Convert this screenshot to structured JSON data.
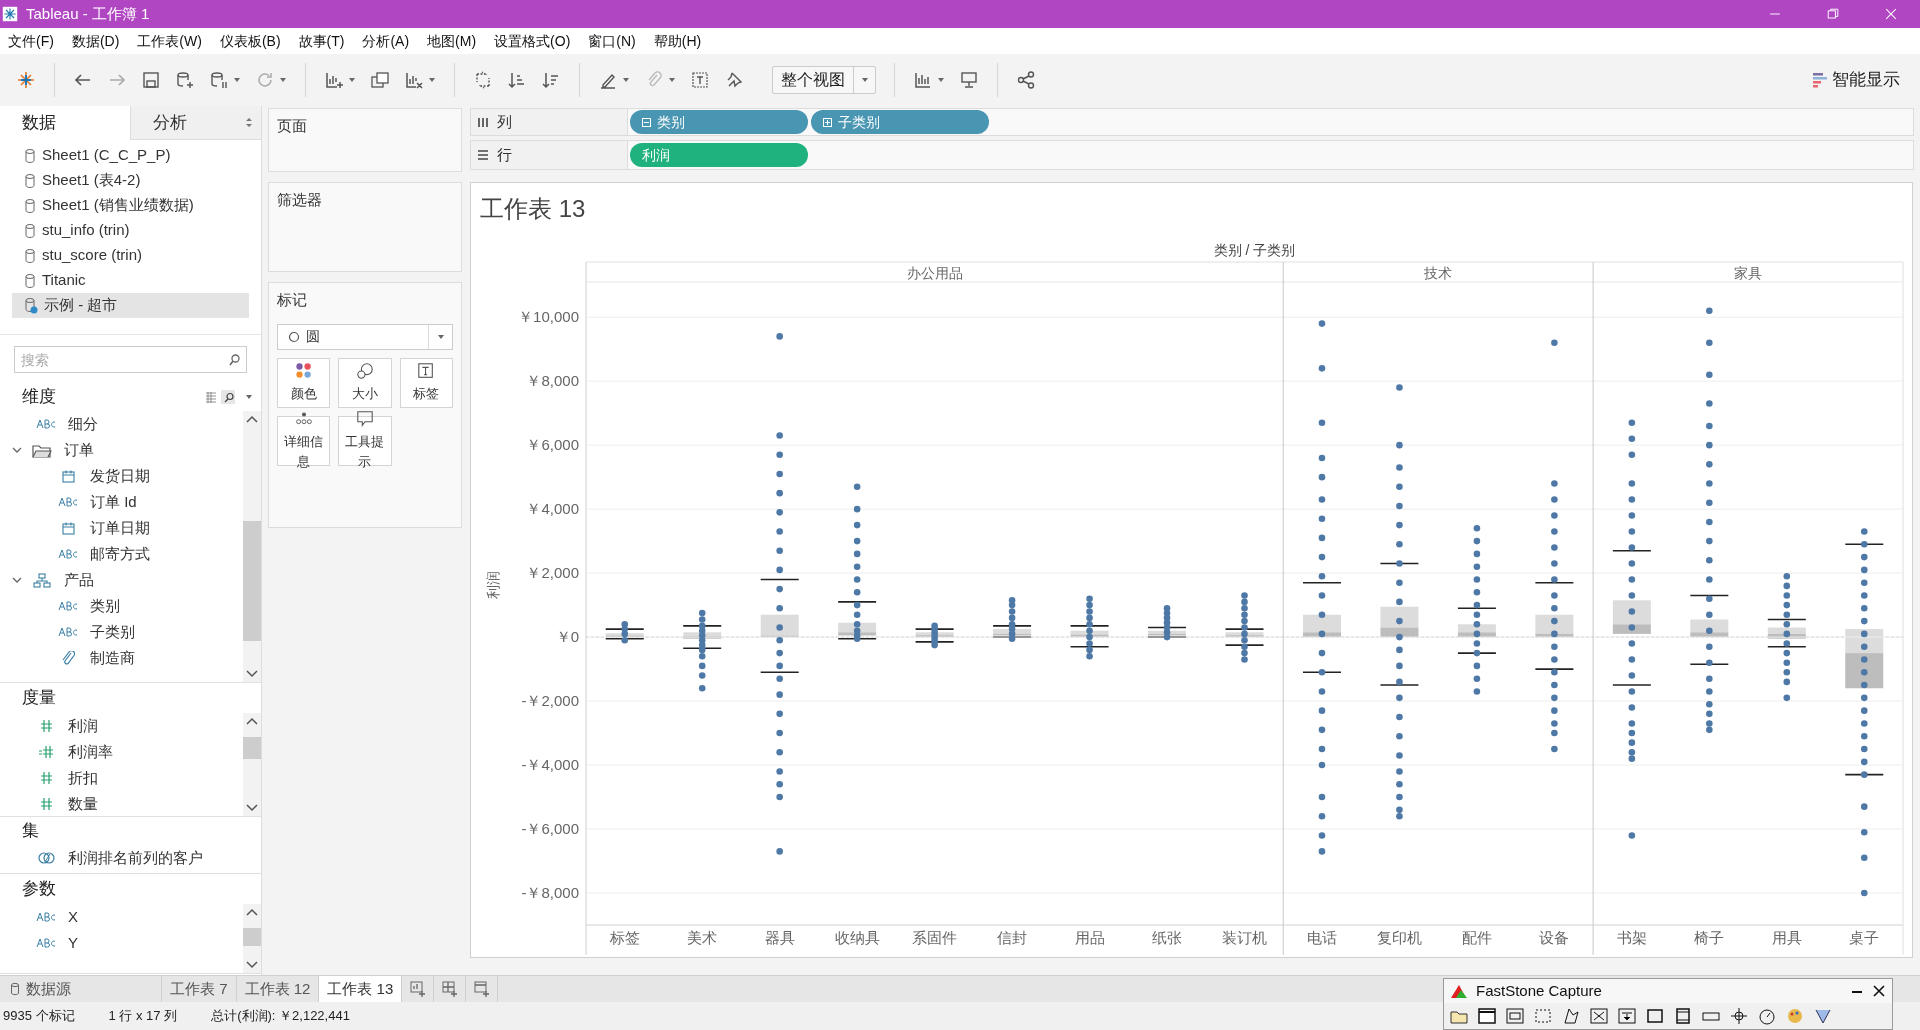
{
  "window": {
    "title": "Tableau - 工作簿 1"
  },
  "menu": [
    "文件(F)",
    "数据(D)",
    "工作表(W)",
    "仪表板(B)",
    "故事(T)",
    "分析(A)",
    "地图(M)",
    "设置格式(O)",
    "窗口(N)",
    "帮助(H)"
  ],
  "toolbar": {
    "fit": "整个视图",
    "show_me": "智能显示"
  },
  "data_pane": {
    "tabs": [
      {
        "label": "数据",
        "selected": true
      },
      {
        "label": "分析",
        "selected": false
      }
    ],
    "sources": [
      {
        "label": "Sheet1 (C_C_P_P)",
        "kind": "file",
        "selected": false
      },
      {
        "label": "Sheet1 (表4-2)",
        "kind": "file",
        "selected": false
      },
      {
        "label": "Sheet1 (销售业绩数据)",
        "kind": "file",
        "selected": false
      },
      {
        "label": "stu_info (trin)",
        "kind": "file",
        "selected": false
      },
      {
        "label": "stu_score (trin)",
        "kind": "file",
        "selected": false
      },
      {
        "label": "Titanic",
        "kind": "file",
        "selected": false
      },
      {
        "label": "示例 - 超市",
        "kind": "live",
        "selected": true
      }
    ],
    "search": {
      "placeholder": "搜索"
    },
    "dimensions": {
      "title": "维度",
      "items": [
        {
          "label": "细分",
          "kind": "abc"
        },
        {
          "label": "订单",
          "kind": "folder",
          "expanded": true,
          "children": [
            {
              "label": "发货日期",
              "kind": "date"
            },
            {
              "label": "订单 Id",
              "kind": "abc"
            },
            {
              "label": "订单日期",
              "kind": "date"
            },
            {
              "label": "邮寄方式",
              "kind": "abc"
            }
          ]
        },
        {
          "label": "产品",
          "kind": "hierarchy",
          "expanded": true,
          "children": [
            {
              "label": "类别",
              "kind": "abc"
            },
            {
              "label": "子类别",
              "kind": "abc"
            },
            {
              "label": "制造商",
              "kind": "group"
            }
          ]
        }
      ]
    },
    "measures": {
      "title": "度量",
      "items": [
        {
          "label": "利润",
          "kind": "number"
        },
        {
          "label": "利润率",
          "kind": "calc"
        },
        {
          "label": "折扣",
          "kind": "number"
        },
        {
          "label": "数量",
          "kind": "number"
        }
      ]
    },
    "sets": {
      "title": "集",
      "items": [
        {
          "label": "利润排名前列的客户",
          "kind": "set"
        }
      ]
    },
    "parameters": {
      "title": "参数",
      "items": [
        {
          "label": "X",
          "kind": "abc"
        },
        {
          "label": "Y",
          "kind": "abc"
        }
      ]
    }
  },
  "shelves": {
    "pages": {
      "title": "页面"
    },
    "filters": {
      "title": "筛选器"
    },
    "marks": {
      "title": "标记",
      "type": "圆",
      "buttons": [
        {
          "label": "颜色",
          "kind": "color"
        },
        {
          "label": "大小",
          "kind": "size"
        },
        {
          "label": "标签",
          "kind": "label"
        },
        {
          "label": "详细信息",
          "kind": "detail"
        },
        {
          "label": "工具提示",
          "kind": "tooltip"
        }
      ]
    }
  },
  "columns": {
    "title": "列",
    "pills": [
      {
        "label": "类别",
        "kind": "collapse",
        "color": "#4996b2"
      },
      {
        "label": "子类别",
        "kind": "expand",
        "color": "#4996b2"
      }
    ]
  },
  "rows": {
    "title": "行",
    "pills": [
      {
        "label": "利润",
        "color": "#1fb27e"
      }
    ]
  },
  "sheet": {
    "title": "工作表 13",
    "groups": [
      {
        "label": "办公用品"
      },
      {
        "label": "技术"
      },
      {
        "label": "家具"
      }
    ],
    "chart_data": {
      "type": "scatter",
      "xlabel": "类别 / 子类别",
      "ylabel": "利润",
      "grid": true,
      "categories": [
        "标签",
        "美术",
        "器具",
        "收纳具",
        "系固件",
        "信封",
        "用品",
        "纸张",
        "装订机",
        "电话",
        "复印机",
        "配件",
        "设备",
        "书架",
        "椅子",
        "用具",
        "桌子"
      ],
      "ylim": [
        -9000,
        11100
      ],
      "yticks": [
        {
          "value": 10000,
          "label": "￥10,000"
        },
        {
          "value": 8000,
          "label": "￥8,000"
        },
        {
          "value": 6000,
          "label": "￥6,000"
        },
        {
          "value": 4000,
          "label": "￥4,000"
        },
        {
          "value": 2000,
          "label": "￥2,000"
        },
        {
          "value": 0,
          "label": "￥0"
        },
        {
          "value": -2000,
          "label": "-￥2,000"
        },
        {
          "value": -4000,
          "label": "-￥4,000"
        },
        {
          "value": -6000,
          "label": "-￥6,000"
        },
        {
          "value": -8000,
          "label": "-￥8,000"
        }
      ],
      "series": [
        {
          "color": "#4e79a7",
          "values": [
            400,
            750,
            9400,
            4700,
            350,
            1150,
            1200,
            900,
            1300,
            9800,
            7800,
            3400,
            9200,
            6700,
            10200,
            1900,
            3300
          ]
        },
        {
          "color": "#4e79a7",
          "values": [
            250,
            550,
            6300,
            4000,
            250,
            1000,
            1000,
            750,
            1100,
            8400,
            6000,
            3000,
            4800,
            6200,
            9200,
            1600,
            2900
          ]
        },
        {
          "color": "#4e79a7",
          "values": [
            100,
            350,
            5700,
            3500,
            150,
            800,
            800,
            600,
            900,
            6700,
            5300,
            2600,
            4300,
            5700,
            8200,
            1300,
            2500
          ]
        },
        {
          "color": "#4e79a7",
          "values": [
            -100,
            200,
            5100,
            3000,
            50,
            600,
            600,
            450,
            700,
            5600,
            4700,
            2200,
            3800,
            4800,
            7300,
            1000,
            2100
          ]
        },
        {
          "color": "#4e79a7",
          "values": [
            null,
            50,
            4500,
            2600,
            -50,
            400,
            400,
            300,
            500,
            5000,
            4100,
            1800,
            3300,
            4300,
            6600,
            700,
            1700
          ]
        },
        {
          "color": "#4e79a7",
          "values": [
            null,
            -100,
            3900,
            2200,
            -150,
            250,
            200,
            150,
            300,
            4300,
            3500,
            1400,
            2800,
            3800,
            6000,
            400,
            1300
          ]
        },
        {
          "color": "#4e79a7",
          "values": [
            null,
            -250,
            3300,
            1800,
            -250,
            100,
            0,
            0,
            100,
            3700,
            2900,
            1000,
            2300,
            3300,
            5400,
            100,
            900
          ]
        },
        {
          "color": "#4e79a7",
          "values": [
            null,
            -400,
            2700,
            1400,
            null,
            -50,
            -200,
            null,
            -100,
            3100,
            2300,
            700,
            1800,
            2800,
            4800,
            -200,
            500
          ]
        },
        {
          "color": "#4e79a7",
          "values": [
            null,
            -600,
            2100,
            1000,
            null,
            null,
            -400,
            null,
            -300,
            2500,
            1700,
            400,
            1300,
            2300,
            4200,
            -500,
            100
          ]
        },
        {
          "color": "#4e79a7",
          "values": [
            null,
            -900,
            1500,
            700,
            null,
            null,
            -600,
            null,
            -500,
            1900,
            1100,
            100,
            900,
            1800,
            3600,
            -800,
            -300
          ]
        },
        {
          "color": "#4e79a7",
          "values": [
            null,
            -1200,
            900,
            400,
            null,
            null,
            null,
            null,
            -700,
            1300,
            500,
            -200,
            500,
            1300,
            3000,
            -1100,
            -700
          ]
        },
        {
          "color": "#4e79a7",
          "values": [
            null,
            -1600,
            300,
            200,
            null,
            null,
            null,
            null,
            null,
            700,
            0,
            -500,
            100,
            800,
            2400,
            -1400,
            -1100
          ]
        },
        {
          "color": "#4e79a7",
          "values": [
            null,
            null,
            -100,
            50,
            null,
            null,
            null,
            null,
            null,
            100,
            -400,
            -900,
            -300,
            300,
            1800,
            -1900,
            -1500
          ]
        },
        {
          "color": "#4e79a7",
          "values": [
            null,
            null,
            -500,
            -50,
            null,
            null,
            null,
            null,
            null,
            -500,
            -900,
            -1300,
            -700,
            -200,
            1200,
            null,
            -1900
          ]
        },
        {
          "color": "#4e79a7",
          "values": [
            null,
            null,
            -900,
            null,
            null,
            null,
            null,
            null,
            null,
            -1100,
            -1400,
            -1700,
            -1100,
            -700,
            700,
            null,
            -2300
          ]
        },
        {
          "color": "#4e79a7",
          "values": [
            null,
            null,
            -1300,
            null,
            null,
            null,
            null,
            null,
            null,
            -1700,
            -1900,
            null,
            -1500,
            -1200,
            200,
            null,
            -2700
          ]
        },
        {
          "color": "#4e79a7",
          "values": [
            null,
            null,
            -1800,
            null,
            null,
            null,
            null,
            null,
            null,
            -2300,
            -2500,
            null,
            -1900,
            -1700,
            -300,
            null,
            -3100
          ]
        },
        {
          "color": "#4e79a7",
          "values": [
            null,
            null,
            -2400,
            null,
            null,
            null,
            null,
            null,
            null,
            -2900,
            -3100,
            null,
            -2300,
            -2200,
            -800,
            null,
            -3500
          ]
        },
        {
          "color": "#4e79a7",
          "values": [
            null,
            null,
            -3000,
            null,
            null,
            null,
            null,
            null,
            null,
            -3500,
            -3700,
            null,
            -2700,
            -2700,
            -1300,
            null,
            -3900
          ]
        },
        {
          "color": "#4e79a7",
          "values": [
            null,
            null,
            -3600,
            null,
            null,
            null,
            null,
            null,
            null,
            -4000,
            -4200,
            null,
            -3000,
            -3000,
            -1700,
            null,
            -4300
          ]
        },
        {
          "color": "#4e79a7",
          "values": [
            null,
            null,
            -4200,
            null,
            null,
            null,
            null,
            null,
            null,
            -5000,
            -4600,
            null,
            -3500,
            -3300,
            -2100,
            null,
            -5300
          ]
        },
        {
          "color": "#4e79a7",
          "values": [
            null,
            null,
            -4600,
            null,
            null,
            null,
            null,
            null,
            null,
            -5600,
            -5000,
            null,
            null,
            -3600,
            -2400,
            null,
            -6100
          ]
        },
        {
          "color": "#4e79a7",
          "values": [
            null,
            null,
            -5000,
            null,
            null,
            null,
            null,
            null,
            null,
            -6200,
            -5400,
            null,
            null,
            -3800,
            -2700,
            null,
            -6900
          ]
        },
        {
          "color": "#4e79a7",
          "values": [
            null,
            null,
            -6700,
            null,
            null,
            null,
            null,
            null,
            null,
            -6700,
            -5600,
            null,
            null,
            -6200,
            -2900,
            null,
            -8000
          ]
        }
      ]
    }
  },
  "sheet_tabs": {
    "source": "数据源",
    "tabs": [
      {
        "label": "工作表 7",
        "selected": false
      },
      {
        "label": "工作表 12",
        "selected": false
      },
      {
        "label": "工作表 13",
        "selected": true
      }
    ]
  },
  "status_bar": [
    "9935 个标记",
    "1 行 x 17 列",
    "总计(利润): ￥2,122,441"
  ],
  "capture_window": {
    "title": "FastStone Capture"
  }
}
